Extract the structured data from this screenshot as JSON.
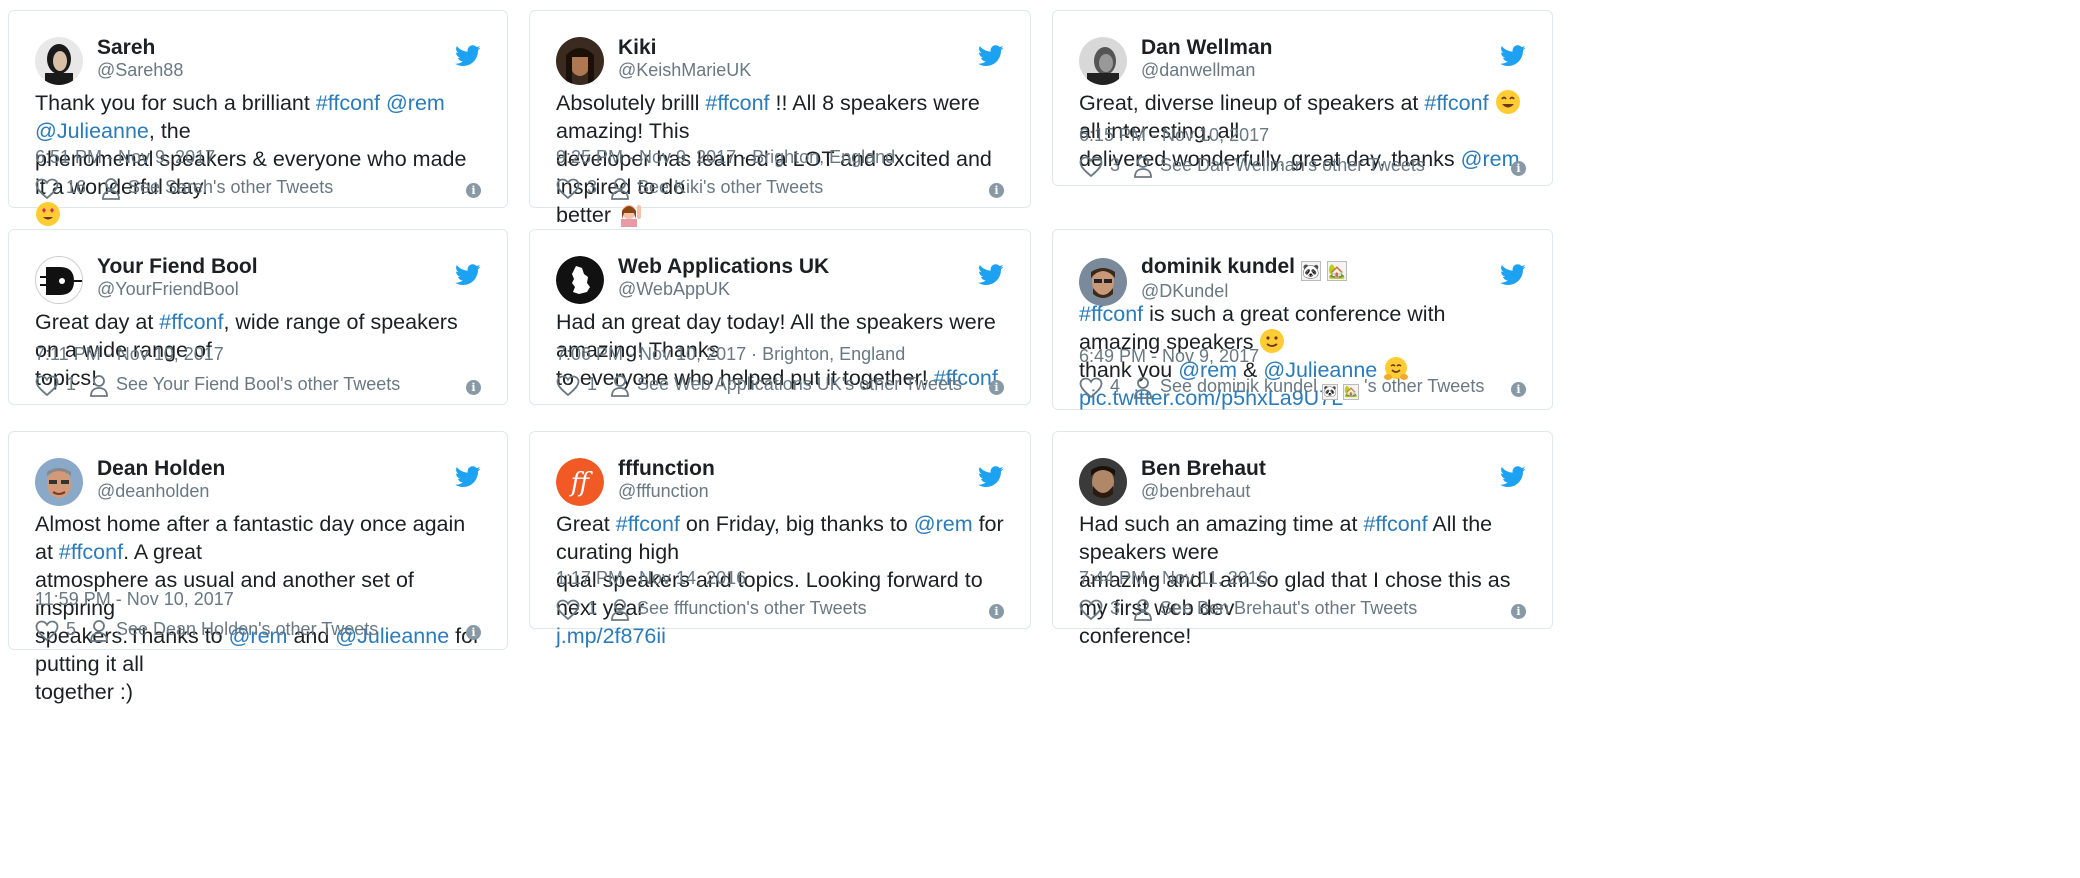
{
  "tweets": [
    {
      "name": "Sareh",
      "handle": "@Sareh88",
      "text": [
        [
          "Thank you for such a brilliant ",
          false
        ],
        [
          "#ffconf",
          true
        ],
        [
          " ",
          false
        ],
        [
          "@rem",
          true
        ],
        [
          " ",
          false
        ],
        [
          "@Julieanne",
          true
        ],
        [
          ", the",
          false
        ]
      ],
      "text2": [
        [
          "phenomenal speakers & everyone who made it a wonderful day.",
          false
        ]
      ],
      "date": "6:51 PM - Nov 9, 2017",
      "likes": "16",
      "other": "See Sareh's other Tweets"
    },
    {
      "name": "Kiki",
      "handle": "@KeishMarieUK",
      "text": [
        [
          "Absolutely brilll ",
          false
        ],
        [
          "#ffconf",
          true
        ],
        [
          " !! All 8 speakers were amazing! This",
          false
        ]
      ],
      "text2": [
        [
          "developer has learned a LOT and excited and inspired to do",
          false
        ]
      ],
      "text3": "better",
      "date": "9:25 PM - Nov 9, 2017 · Brighton, England",
      "likes": "3",
      "other": "See Kiki's other Tweets"
    },
    {
      "name": "Dan Wellman",
      "handle": "@danwellman",
      "text": [
        [
          "Great, diverse lineup of speakers at ",
          false
        ],
        [
          "#ffconf",
          true
        ]
      ],
      "text_after_emoji": " all interesting, all",
      "text2": [
        [
          "delivered wonderfully, great day, thanks ",
          false
        ],
        [
          "@rem",
          true
        ]
      ],
      "date": "6:15 PM - Nov 10, 2017",
      "likes": "3",
      "other": "See Dan Wellman's other Tweets"
    },
    {
      "name": "Your Fiend Bool",
      "handle": "@YourFriendBool",
      "text": [
        [
          "Great day at ",
          false
        ],
        [
          "#ffconf",
          true
        ],
        [
          ", wide range of speakers on a wide range of",
          false
        ]
      ],
      "text2": [
        [
          "topics!",
          false
        ]
      ],
      "date": "7:11 PM - Nov 10, 2017",
      "likes": "1",
      "other": "See Your Fiend Bool's other Tweets"
    },
    {
      "name": "Web Applications UK",
      "handle": "@WebAppUK",
      "text": [
        [
          "Had an great day today! All the speakers were amazing! Thanks",
          false
        ]
      ],
      "text2": [
        [
          "to everyone who helped put it together! ",
          false
        ],
        [
          "#ffconf",
          true
        ]
      ],
      "date": "7:06 PM - Nov 10, 2017 · Brighton, England",
      "likes": "1",
      "other": "See Web Applications UK's other Tweets"
    },
    {
      "name": "dominik kundel",
      "handle": "@DKundel",
      "text": [
        [
          "#ffconf",
          true
        ],
        [
          " is such a great conference with amazing speakers",
          false
        ]
      ],
      "text2": [
        [
          "thank you ",
          false
        ],
        [
          "@rem",
          true
        ],
        [
          " & ",
          false
        ],
        [
          "@Julieanne",
          true
        ]
      ],
      "text2_link": "pic.twitter.com/p5hxLa9U7L",
      "date": "6:49 PM - Nov 9, 2017",
      "likes": "4",
      "other_pre": "See dominik kundel",
      "other_post": "'s other Tweets"
    },
    {
      "name": "Dean Holden",
      "handle": "@deanholden",
      "text": [
        [
          "Almost home after a fantastic day once again at ",
          false
        ],
        [
          "#ffconf",
          true
        ],
        [
          ". A great",
          false
        ]
      ],
      "text2": [
        [
          "atmosphere as usual and another set of inspiring",
          false
        ]
      ],
      "text3": [
        [
          "speakers.Thanks to ",
          false
        ],
        [
          "@rem",
          true
        ],
        [
          " and ",
          false
        ],
        [
          "@Julieanne",
          true
        ],
        [
          " for putting it all",
          false
        ]
      ],
      "text4": "together :)",
      "date": "11:59 PM - Nov 10, 2017",
      "likes": "5",
      "other": "See Dean Holden's other Tweets"
    },
    {
      "name": "fffunction",
      "handle": "@fffunction",
      "text": [
        [
          "Great ",
          false
        ],
        [
          "#ffconf",
          true
        ],
        [
          " on Friday, big thanks to ",
          false
        ],
        [
          "@rem",
          true
        ],
        [
          " for curating high",
          false
        ]
      ],
      "text2": [
        [
          "qual speakers and topics. Looking forward to next year",
          false
        ]
      ],
      "text3": [
        [
          "j.mp/2f876ii",
          true
        ]
      ],
      "date": "1:17 PM - Nov 14, 2016",
      "likes": "1",
      "other": "See fffunction's other Tweets"
    },
    {
      "name": "Ben Brehaut",
      "handle": "@benbrehaut",
      "text": [
        [
          "Had such an amazing time at ",
          false
        ],
        [
          "#ffconf",
          true
        ],
        [
          " All the speakers were",
          false
        ]
      ],
      "text2": [
        [
          "amazing and I am so glad that I chose this as my first web dev",
          false
        ]
      ],
      "text3": [
        [
          "conference!",
          false
        ]
      ],
      "date": "7:44 PM - Nov 11, 2016",
      "likes": "3",
      "other": "See Ben Brehaut's other Tweets"
    }
  ],
  "icons": [
    "twitter-bird-icon",
    "heart-icon",
    "person-icon",
    "info-icon"
  ],
  "colors": {
    "link": "#2b7bb9",
    "twitter": "#1da1f2",
    "muted": "#697882",
    "border": "#e1e8ed"
  }
}
